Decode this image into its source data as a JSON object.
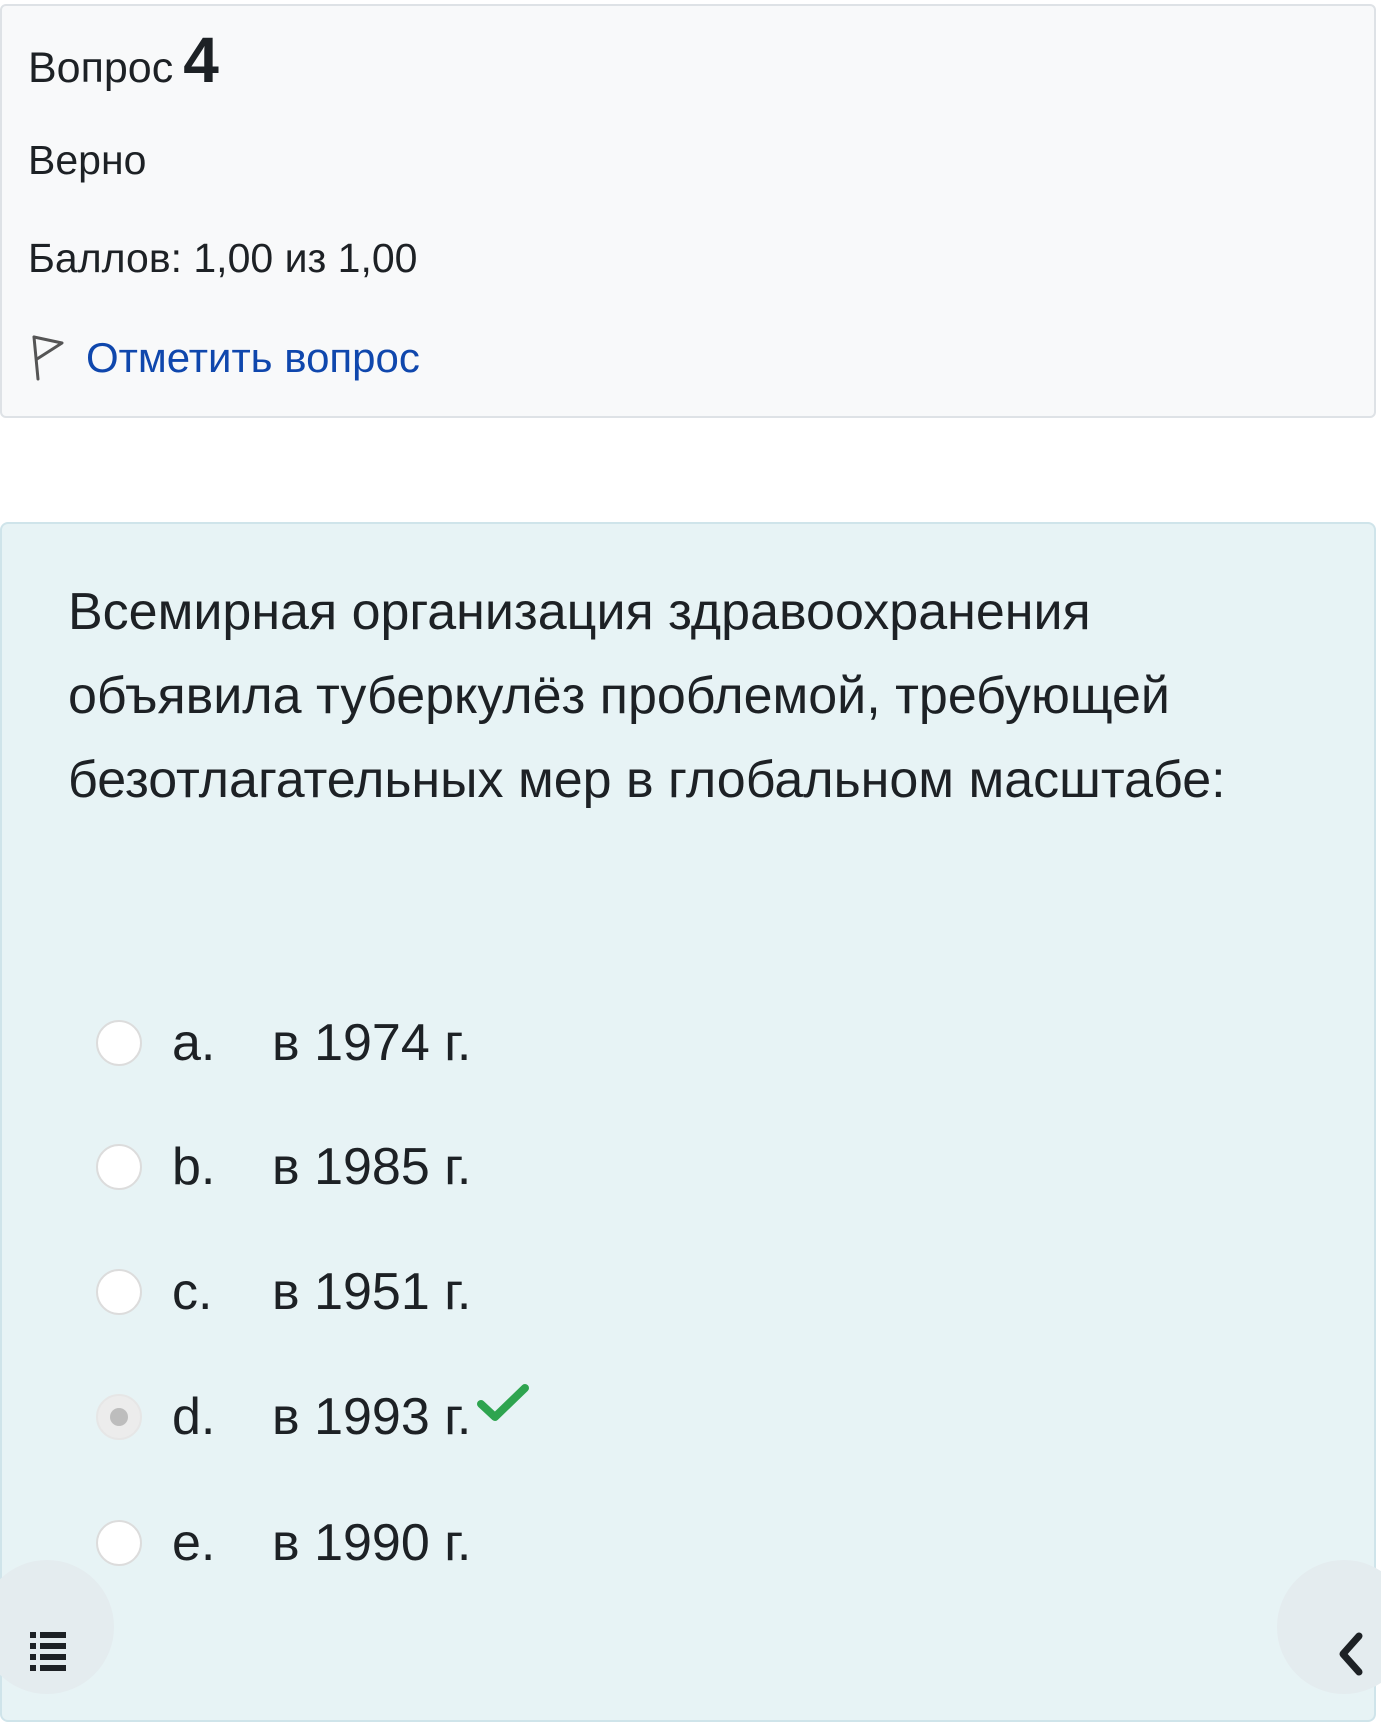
{
  "question_info": {
    "label": "Вопрос",
    "number": "4",
    "state": "Верно",
    "grade": "Баллов: 1,00 из 1,00",
    "flag_label": "Отметить вопрос"
  },
  "question": {
    "text": "Всемирная организация здравоохранения объявила туберкулёз проблемой, требующей безотлагательных мер в глобальном масштабе:",
    "answers": [
      {
        "letter": "a.",
        "text": "в 1974 г.",
        "selected": false,
        "correct": false
      },
      {
        "letter": "b.",
        "text": "в 1985 г.",
        "selected": false,
        "correct": false
      },
      {
        "letter": "c.",
        "text": "в 1951 г.",
        "selected": false,
        "correct": false
      },
      {
        "letter": "d.",
        "text": "в 1993 г.",
        "selected": true,
        "correct": true
      },
      {
        "letter": "e.",
        "text": "в 1990 г.",
        "selected": false,
        "correct": false
      }
    ]
  },
  "icons": {
    "flag": "flag-icon",
    "correct": "check-icon",
    "drawer": "list-icon",
    "back": "chevron-left-icon"
  },
  "colors": {
    "link": "#0f47ad",
    "correct_check": "#2ea44f",
    "content_bg": "#e7f3f5",
    "info_bg": "#f8f9fa"
  }
}
